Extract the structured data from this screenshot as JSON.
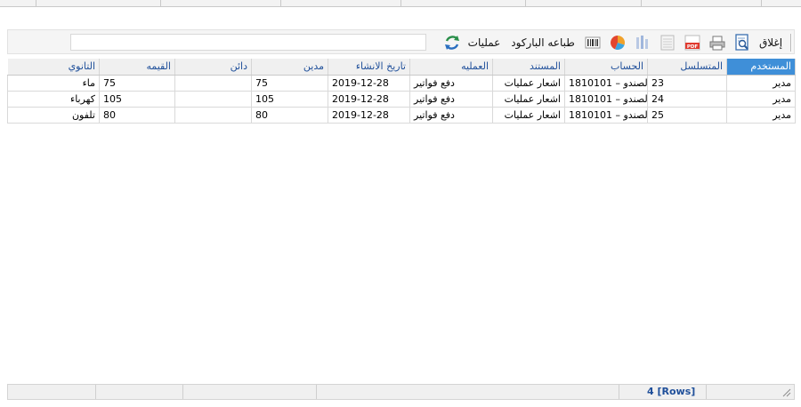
{
  "toolbar": {
    "close_label": "إغلاق",
    "barcode_label": "طباعه الباركود",
    "operations_label": "عمليات",
    "search_value": "",
    "icons": [
      "print-preview-icon",
      "print-icon",
      "pdf-export-icon",
      "excel-export-icon",
      "column-chooser-icon",
      "chart-icon",
      "barcode-icon",
      "refresh-icon"
    ]
  },
  "grid": {
    "columns": [
      "المستخدم",
      "المتسلسل",
      "الحساب",
      "المستند",
      "العمليه",
      "تاريخ الانشاء",
      "مدين",
      "دائن",
      "القيمه",
      "التانوي"
    ],
    "rows": [
      [
        "مدير",
        "23",
        "1810101 – الصندو",
        "اشعار عمليات",
        "دفع فواتير",
        "2019-12-28",
        "75",
        "",
        "75",
        "ماء"
      ],
      [
        "مدير",
        "24",
        "1810101 – الصندو",
        "اشعار عمليات",
        "دفع فواتير",
        "2019-12-28",
        "105",
        "",
        "105",
        "كهرباء"
      ],
      [
        "مدير",
        "25",
        "1810101 – الصندو",
        "اشعار عمليات",
        "دفع فواتير",
        "2019-12-28",
        "80",
        "",
        "80",
        "تلفون"
      ]
    ]
  },
  "status": {
    "rows_label": "4 [Rows]"
  },
  "colors": {
    "active_header": "#3f8fd8",
    "header_text": "#1f4f9a"
  }
}
